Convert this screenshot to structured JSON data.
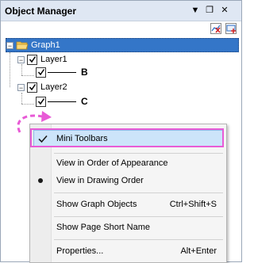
{
  "window": {
    "title": "Object Manager",
    "buttons": {
      "menu": "▼",
      "restore": "❐",
      "close": "✕"
    }
  },
  "toolbar": {
    "icons": [
      "chart-delete-icon",
      "chart-add-icon"
    ]
  },
  "tree": {
    "graph": {
      "label": "Graph1",
      "expanded": true
    },
    "layers": [
      {
        "label": "Layer1",
        "checked": true,
        "child_checked": true,
        "callout": "B"
      },
      {
        "label": "Layer2",
        "checked": true,
        "child_checked": true,
        "callout": "C"
      }
    ]
  },
  "annotation": {
    "color": "#e85bd6"
  },
  "context_menu": {
    "items": [
      {
        "label": "Mini Toolbars",
        "shortcut": "",
        "checked": true,
        "highlighted": true
      },
      {
        "label": "View in Order of Appearance",
        "shortcut": "",
        "checked": false
      },
      {
        "label": "View in Drawing Order",
        "shortcut": "",
        "radio": true
      },
      {
        "label": "Show Graph Objects",
        "shortcut": "Ctrl+Shift+S"
      },
      {
        "label": "Show Page Short Name",
        "shortcut": ""
      },
      {
        "label": "Properties...",
        "shortcut": "Alt+Enter"
      }
    ]
  },
  "colors": {
    "titlebar": "#dfe7f3",
    "selection": "#3476c8",
    "menu_highlight": "#cce4fa",
    "pink_annotation": "#e85bd6"
  }
}
